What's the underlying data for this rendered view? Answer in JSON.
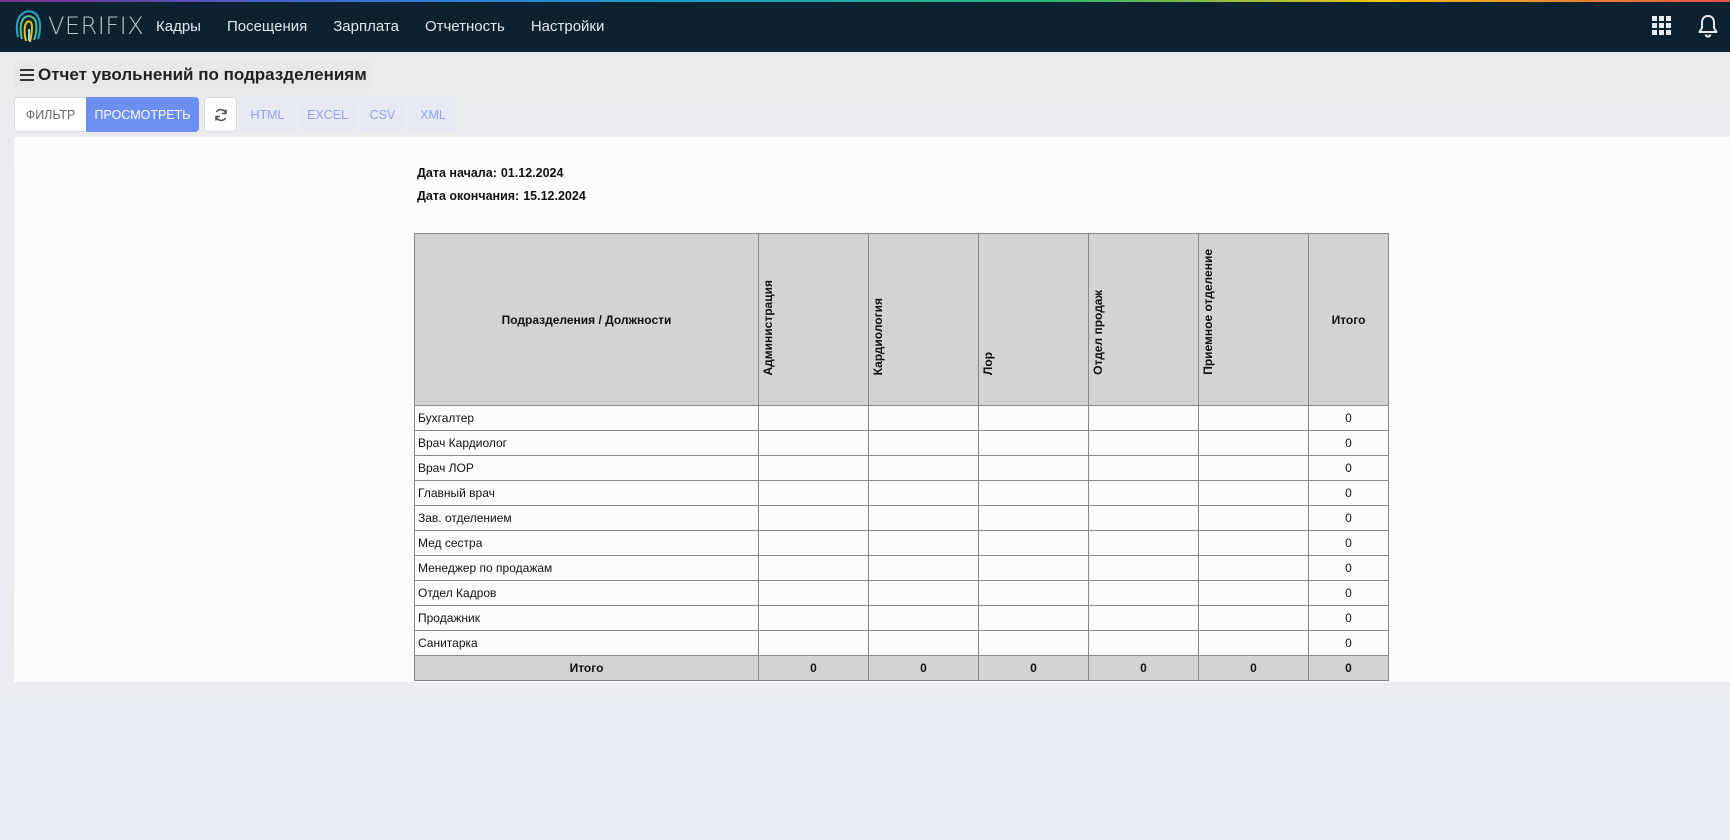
{
  "app": {
    "logo_text": "VERIFIX",
    "nav": [
      "Кадры",
      "Посещения",
      "Зарплата",
      "Отчетность",
      "Настройки"
    ],
    "icons": {
      "apps": "grid-apps-icon",
      "notifications": "bell-icon",
      "menu": "hamburger-menu-icon",
      "refresh": "refresh-icon"
    }
  },
  "page": {
    "title": "Отчет увольнений по подразделениям"
  },
  "toolbar": {
    "filter_label": "ФИЛЬТР",
    "view_label": "ПРОСМОТРЕТЬ",
    "formats": [
      "HTML",
      "EXCEL",
      "CSV",
      "XML"
    ]
  },
  "report": {
    "start_label": "Дата начала:",
    "start_value": "01.12.2024",
    "end_label": "Дата окончания:",
    "end_value": "15.12.2024",
    "corner_header": "Подразделения / Должности",
    "departments": [
      "Администрация",
      "Кардиология",
      "Лор",
      "Отдел продаж",
      "Приемное отделение"
    ],
    "total_header": "Итого",
    "rows": [
      {
        "name": "Бухгалтер",
        "values": [
          "",
          "",
          "",
          "",
          ""
        ],
        "total": "0"
      },
      {
        "name": "Врач Кардиолог",
        "values": [
          "",
          "",
          "",
          "",
          ""
        ],
        "total": "0"
      },
      {
        "name": "Врач ЛОР",
        "values": [
          "",
          "",
          "",
          "",
          ""
        ],
        "total": "0"
      },
      {
        "name": "Главный врач",
        "values": [
          "",
          "",
          "",
          "",
          ""
        ],
        "total": "0"
      },
      {
        "name": "Зав. отделением",
        "values": [
          "",
          "",
          "",
          "",
          ""
        ],
        "total": "0"
      },
      {
        "name": "Мед сестра",
        "values": [
          "",
          "",
          "",
          "",
          ""
        ],
        "total": "0"
      },
      {
        "name": "Менеджер по продажам",
        "values": [
          "",
          "",
          "",
          "",
          ""
        ],
        "total": "0"
      },
      {
        "name": "Отдел Кадров",
        "values": [
          "",
          "",
          "",
          "",
          ""
        ],
        "total": "0"
      },
      {
        "name": "Продажник",
        "values": [
          "",
          "",
          "",
          "",
          ""
        ],
        "total": "0"
      },
      {
        "name": "Санитарка",
        "values": [
          "",
          "",
          "",
          "",
          ""
        ],
        "total": "0"
      }
    ],
    "summary": {
      "label": "Итого",
      "values": [
        "0",
        "0",
        "0",
        "0",
        "0"
      ],
      "total": "0"
    }
  },
  "colors": {
    "nav_bg": "#0c2230",
    "accent": "#6c8ff0",
    "header_cell": "#d3d3d3"
  }
}
